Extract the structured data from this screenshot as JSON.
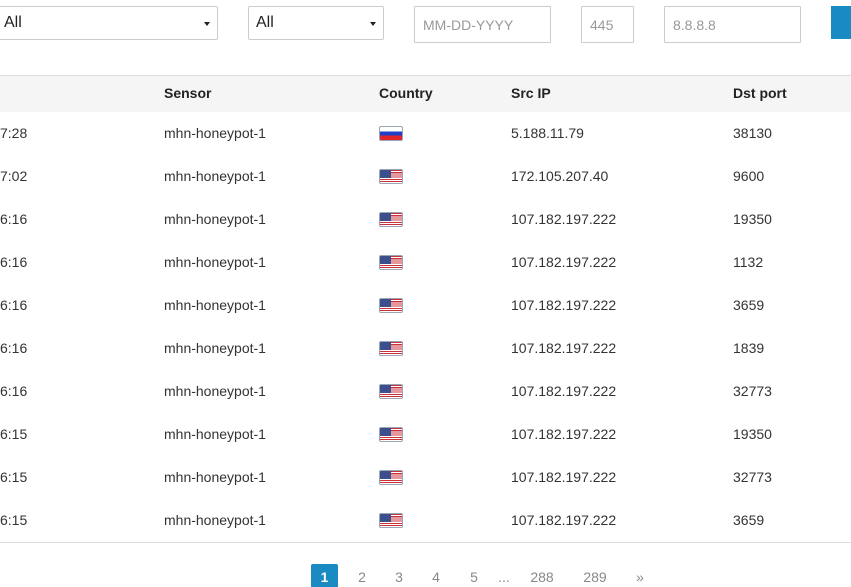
{
  "filters": {
    "select1_value": "All",
    "select2_value": "All",
    "date_placeholder": "MM-DD-YYYY",
    "port_placeholder": "445",
    "ip_placeholder": "8.8.8.8"
  },
  "table": {
    "headers": {
      "sensor": "Sensor",
      "country": "Country",
      "src_ip": "Src IP",
      "dst_port": "Dst port"
    },
    "rows": [
      {
        "time": "7:28",
        "sensor": "mhn-honeypot-1",
        "country_flag": "flag-ru-icon",
        "src_ip": "5.188.11.79",
        "dst_port": "38130"
      },
      {
        "time": "7:02",
        "sensor": "mhn-honeypot-1",
        "country_flag": "flag-us-icon",
        "src_ip": "172.105.207.40",
        "dst_port": "9600"
      },
      {
        "time": "6:16",
        "sensor": "mhn-honeypot-1",
        "country_flag": "flag-us-icon",
        "src_ip": "107.182.197.222",
        "dst_port": "19350"
      },
      {
        "time": "6:16",
        "sensor": "mhn-honeypot-1",
        "country_flag": "flag-us-icon",
        "src_ip": "107.182.197.222",
        "dst_port": "1132"
      },
      {
        "time": "6:16",
        "sensor": "mhn-honeypot-1",
        "country_flag": "flag-us-icon",
        "src_ip": "107.182.197.222",
        "dst_port": "3659"
      },
      {
        "time": "6:16",
        "sensor": "mhn-honeypot-1",
        "country_flag": "flag-us-icon",
        "src_ip": "107.182.197.222",
        "dst_port": "1839"
      },
      {
        "time": "6:16",
        "sensor": "mhn-honeypot-1",
        "country_flag": "flag-us-icon",
        "src_ip": "107.182.197.222",
        "dst_port": "32773"
      },
      {
        "time": "6:15",
        "sensor": "mhn-honeypot-1",
        "country_flag": "flag-us-icon",
        "src_ip": "107.182.197.222",
        "dst_port": "19350"
      },
      {
        "time": "6:15",
        "sensor": "mhn-honeypot-1",
        "country_flag": "flag-us-icon",
        "src_ip": "107.182.197.222",
        "dst_port": "32773"
      },
      {
        "time": "6:15",
        "sensor": "mhn-honeypot-1",
        "country_flag": "flag-us-icon",
        "src_ip": "107.182.197.222",
        "dst_port": "3659"
      }
    ]
  },
  "pagination": {
    "active_page": "1",
    "pages": [
      "1",
      "2",
      "3",
      "4",
      "5",
      "...",
      "288",
      "289",
      "»"
    ]
  },
  "colors": {
    "accent": "#1a8ac2",
    "header_bg": "#f5f5f5"
  }
}
